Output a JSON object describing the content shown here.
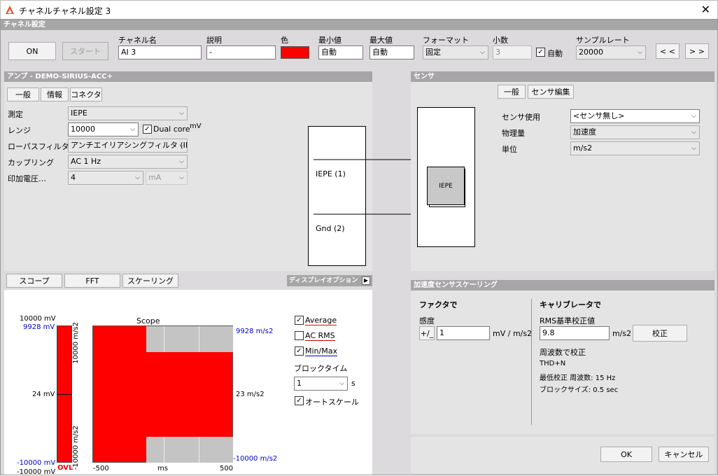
{
  "window": {
    "title": "チャネルチャネル設定 3",
    "close": "✕"
  },
  "channel_settings": {
    "header": "チャネル設定",
    "on_button": "ON",
    "start_button": "スタート",
    "fields": {
      "channel_name": {
        "label": "チャネル名",
        "value": "AI 3"
      },
      "description": {
        "label": "説明",
        "value": "-"
      },
      "color": {
        "label": "色",
        "value": "#ff0000"
      },
      "min": {
        "label": "最小値",
        "value": "自動"
      },
      "max": {
        "label": "最大値",
        "value": "自動"
      },
      "format": {
        "label": "フォーマット",
        "value": "固定"
      },
      "decimals": {
        "label": "小数",
        "value": "3",
        "auto_label": "自動",
        "auto_checked": true
      },
      "sample_rate": {
        "label": "サンプルレート",
        "value": "20000"
      }
    },
    "prev_button": "< <",
    "next_button": "> >"
  },
  "amp": {
    "header": "アンプ - DEMO-SIRIUS-ACC+",
    "tabs": [
      "一般",
      "情報",
      "コネクタ"
    ],
    "rows": {
      "measurement": {
        "label": "測定",
        "value": "IEPE"
      },
      "range": {
        "label": "レンジ",
        "value": "10000",
        "dual_core": "Dual core",
        "dual_core_checked": true,
        "unit": "mV"
      },
      "lowpass": {
        "label": "ローパスフィルタ",
        "value": "アンチエイリアシングフィルタ (IIR)"
      },
      "coupling": {
        "label": "カップリング",
        "value": "AC  1 Hz"
      },
      "excitation": {
        "label": "印加電圧…",
        "value": "4",
        "unit": "mA"
      }
    },
    "diagram": {
      "iepe_label": "IEPE (1)",
      "gnd_label": "Gnd (2)"
    }
  },
  "sensor": {
    "header": "センサ",
    "tabs": [
      "一般",
      "センサ編集"
    ],
    "rows": {
      "use": {
        "label": "センサ使用",
        "value": "<センサ無し>"
      },
      "quantity": {
        "label": "物理量",
        "value": "加速度"
      },
      "unit": {
        "label": "単位",
        "value": "m/s2"
      }
    },
    "block_label": "IEPE"
  },
  "scope": {
    "tabs": [
      "スコープ",
      "FFT",
      "スケーリング"
    ],
    "display_options": "ディスプレイオプション",
    "title": "Scope",
    "left": {
      "top": "10000 mV",
      "top_blue": "9928 mV",
      "mid": "24 mV",
      "bottom_blue": "-10000 mV",
      "bottom": "-10000 mV",
      "ovl": "OVL"
    },
    "y_inner": {
      "top": "10000 m/s2",
      "bottom": "-10000 m/s2"
    },
    "right": {
      "top": "9928 m/s2",
      "mid": "23 m/s2",
      "bottom": "-10000 m/s2"
    },
    "x_axis": {
      "min": "-500",
      "label": "ms",
      "max": "500"
    },
    "options": {
      "average": {
        "label": "Average",
        "checked": true,
        "color": "#ff0000"
      },
      "ac_rms": {
        "label": "AC RMS",
        "checked": false,
        "color": "#cc0000"
      },
      "min_max": {
        "label": "Min/Max",
        "checked": true,
        "color": "#0000cc"
      },
      "block_time_label": "ブロックタイム",
      "block_time_value": "1",
      "block_time_unit": "s",
      "autoscale": {
        "label": "オートスケール",
        "checked": true
      }
    }
  },
  "scaling": {
    "header": "加速度センサスケーリング",
    "factor": {
      "title": "ファクタで",
      "sensitivity_label": "感度",
      "sign_button": "+/_",
      "value": "1",
      "unit": "mV / m/s2"
    },
    "calibrator": {
      "title": "キャリブレータで",
      "rms_label": "RMS基準校正値",
      "value": "9.8",
      "unit": "m/s2",
      "calibrate_button": "校正",
      "freq_label": "周波数で校正",
      "thd": "THD+N",
      "min_freq": "最低校正 周波数: 15 Hz",
      "block_size": "ブロックサイズ: 0.5 sec"
    }
  },
  "footer": {
    "ok": "OK",
    "cancel": "キャンセル"
  },
  "checkmark": "✓",
  "chevron": "⌵"
}
